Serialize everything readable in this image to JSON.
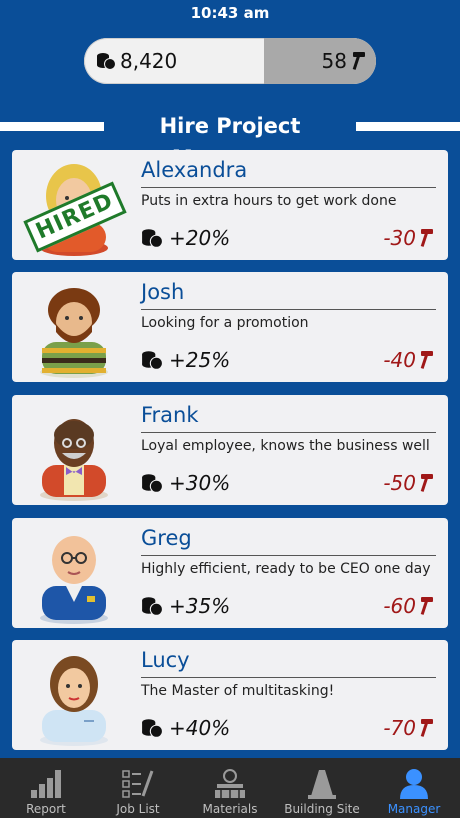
{
  "status": {
    "time": "10:43 am"
  },
  "resources": {
    "coins": "8,420",
    "hammers": "58"
  },
  "section": {
    "title": "Hire Project Managers"
  },
  "managers": [
    {
      "name": "Alexandra",
      "description": "Puts in extra hours to get work done",
      "bonus": "+20%",
      "cost": "-30",
      "stamp": "HIRED"
    },
    {
      "name": "Josh",
      "description": "Looking for a promotion",
      "bonus": "+25%",
      "cost": "-40"
    },
    {
      "name": "Frank",
      "description": "Loyal employee, knows the business well",
      "bonus": "+30%",
      "cost": "-50"
    },
    {
      "name": "Greg",
      "description": "Highly efficient, ready to be CEO one day",
      "bonus": "+35%",
      "cost": "-60"
    },
    {
      "name": "Lucy",
      "description": "The Master of multitasking!",
      "bonus": "+40%",
      "cost": "-70"
    }
  ],
  "tabs": [
    {
      "label": "Report",
      "icon": "bar-chart-icon"
    },
    {
      "label": "Job List",
      "icon": "checklist-icon"
    },
    {
      "label": "Materials",
      "icon": "materials-icon"
    },
    {
      "label": "Building Site",
      "icon": "traffic-cone-icon"
    },
    {
      "label": "Manager",
      "icon": "person-icon",
      "active": true
    }
  ],
  "colors": {
    "background": "#0a4e98",
    "name": "#0a4e98",
    "cost": "#a01818",
    "active_tab": "#3b91ff",
    "hired_stamp": "#1f7a2a"
  }
}
